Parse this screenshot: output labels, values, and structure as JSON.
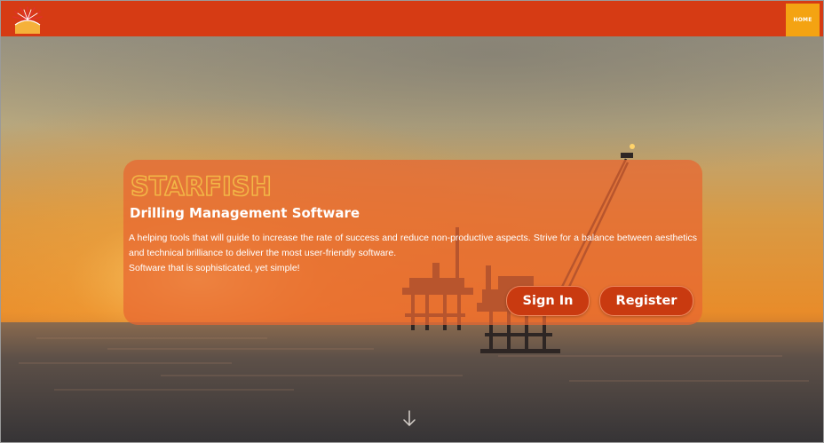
{
  "nav": {
    "logo_icon": "sunrise-logo-icon",
    "home_label": "HOME"
  },
  "hero": {
    "brand_name": "STARFISH",
    "subtitle": "Drilling Management Software",
    "description_lines": [
      "A helping tools that will guide to increase the rate of success and reduce non-productive aspects. Strive for a balance between aesthetics and technical brilliance to deliver the most user-friendly software.",
      "Software that is sophisticated, yet simple!"
    ],
    "sign_in_label": "Sign In",
    "register_label": "Register",
    "scroll_icon": "arrow-down-icon"
  },
  "colors": {
    "navbar": "#d63b14",
    "home_button": "#f4a312",
    "panel": "#e86630",
    "button": "#c93a10",
    "brand_text": "#f2b646"
  }
}
